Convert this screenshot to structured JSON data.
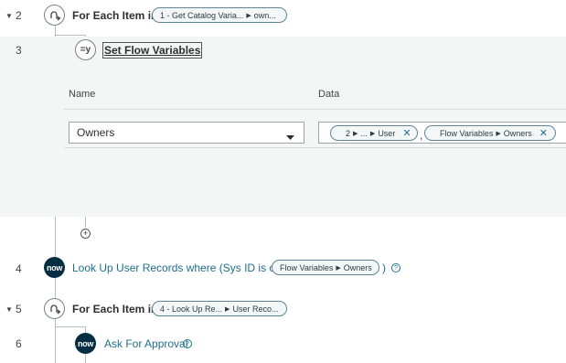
{
  "rows": {
    "row2": {
      "number": "2",
      "caret": "▼",
      "keyword": "For Each Item in",
      "pill_a": "1 - Get Catalog Varia...",
      "pill_b": "own..."
    },
    "row3": {
      "number": "3",
      "action_icon_text": "=y",
      "action_label": "Set Flow Variables",
      "name_header": "Name",
      "data_header": "Data",
      "name_select_value": "Owners",
      "data_pill1_a": "2",
      "data_pill1_b": "...",
      "data_pill1_c": "User",
      "separator": ",",
      "data_pill2_a": "Flow Variables",
      "data_pill2_b": "Owners"
    },
    "row4": {
      "number": "4",
      "label": "Look Up User Records where (Sys ID is one of",
      "pill_a": "Flow Variables",
      "pill_b": "Owners",
      "close_paren": ")"
    },
    "row5": {
      "number": "5",
      "caret": "▼",
      "keyword": "For Each Item in",
      "pill_a": "4 - Look Up Re...",
      "pill_b": "User Reco..."
    },
    "row6": {
      "number": "6",
      "label": "Ask For Approval"
    }
  },
  "icons": {
    "logo_text": "now",
    "help_symbol": "?",
    "add_symbol": "+",
    "remove_symbol": "✕",
    "pill_separator": "▶"
  },
  "colors": {
    "accent": "#1f6f8b",
    "logo_bg": "#032d42",
    "panel_bg": "#f4f5f5",
    "pill_border": "#5c8596"
  }
}
